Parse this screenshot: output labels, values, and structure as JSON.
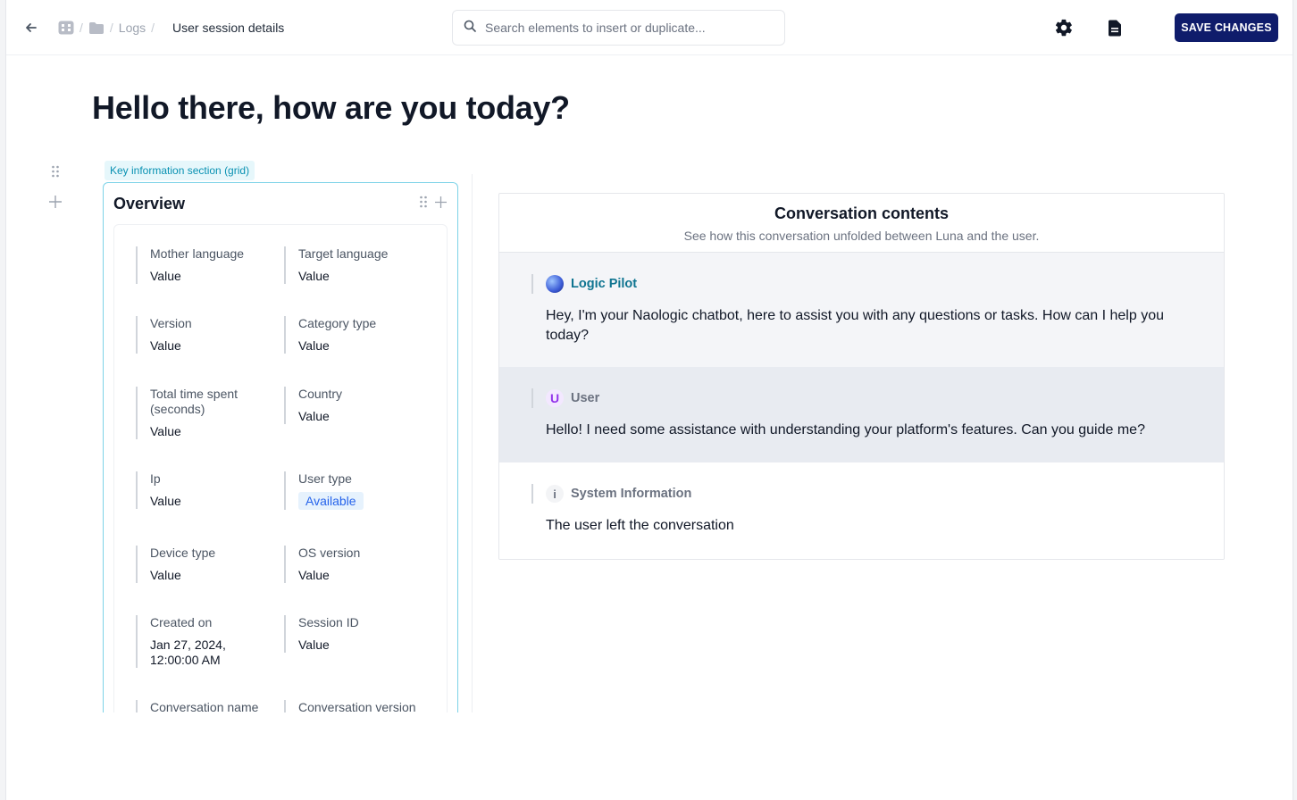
{
  "breadcrumb": {
    "separator": "/",
    "logs": "Logs",
    "current": "User session details"
  },
  "search": {
    "placeholder": "Search elements to insert or duplicate..."
  },
  "toolbar": {
    "save_label": "SAVE CHANGES"
  },
  "page": {
    "title": "Hello there, how are you today?"
  },
  "section": {
    "tag": "Key information section (grid)"
  },
  "overview": {
    "title": "Overview",
    "fields": [
      {
        "label": "Mother language",
        "value": "Value"
      },
      {
        "label": "Target language",
        "value": "Value"
      },
      {
        "label": "Version",
        "value": "Value"
      },
      {
        "label": "Category type",
        "value": "Value"
      },
      {
        "label": "Total time spent (seconds)",
        "value": "Value"
      },
      {
        "label": "Country",
        "value": "Value"
      },
      {
        "label": "Ip",
        "value": "Value"
      },
      {
        "label": "User type",
        "value": "Available"
      },
      {
        "label": "Device type",
        "value": "Value"
      },
      {
        "label": "OS version",
        "value": "Value"
      },
      {
        "label": "Created on",
        "value": "Jan 27, 2024, 12:00:00 AM"
      },
      {
        "label": "Session ID",
        "value": "Value"
      },
      {
        "label": "Conversation name",
        "value": ""
      },
      {
        "label": "Conversation version",
        "value": ""
      }
    ]
  },
  "conversation": {
    "title": "Conversation contents",
    "subtitle": "See how this conversation unfolded between Luna and the user.",
    "messages": [
      {
        "sender": "Logic Pilot",
        "avatar": "",
        "text": "Hey, I'm your Naologic chatbot, here to assist you with any questions or tasks. How can I help you today?"
      },
      {
        "sender": "User",
        "avatar": "U",
        "text": "Hello! I need some assistance with understanding your platform's features. Can you guide me?"
      },
      {
        "sender": "System Information",
        "avatar": "i",
        "text": "The user left the conversation"
      }
    ]
  },
  "colors": {
    "brand": "#0f1c6b",
    "accent": "#0891b2",
    "bot_name": "#0e7490",
    "user_name": "#6b7280",
    "user_row_bg": "#e8ebf1",
    "bot_row_bg": "#f4f5f8"
  },
  "icons": [
    "back-arrow-icon",
    "grid-icon",
    "folder-icon",
    "search-icon",
    "gear-icon",
    "document-icon",
    "drag-handle-icon",
    "plus-icon"
  ]
}
